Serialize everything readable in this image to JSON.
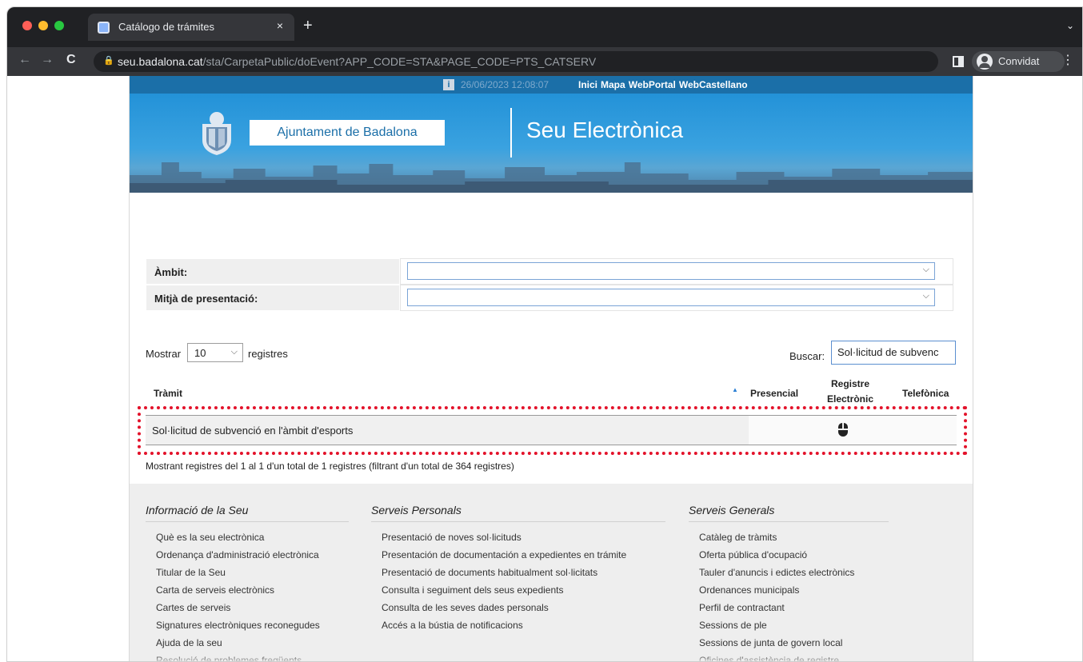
{
  "browser": {
    "tab_title": "Catálogo de trámites",
    "tab_close": "×",
    "new_tab": "+",
    "tab_menu": "⌄",
    "url_host": "seu.badalona.cat",
    "url_path": "/sta/CarpetaPublic/doEvent?APP_CODE=STA&PAGE_CODE=PTS_CATSERV",
    "profile_label": "Convidat",
    "back": "←",
    "forward": "→",
    "reload": "C",
    "menu": "⋮"
  },
  "topbar": {
    "info_icon": "i",
    "datetime": "26/06/2023 12:08:07",
    "links": [
      "Inici",
      "Mapa",
      "WebPortal",
      "WebCastellano"
    ]
  },
  "banner": {
    "org_name": "Ajuntament de Badalona",
    "site_title": "Seu Electrònica"
  },
  "filters": {
    "ambit_label": "Àmbit:",
    "mitja_label": "Mitjà de presentació:",
    "chevron": "⌵"
  },
  "table_controls": {
    "show_label": "Mostrar",
    "page_size": "10",
    "show_suffix": "registres",
    "search_label": "Buscar:",
    "search_value": "Sol·licitud de subvenc"
  },
  "table": {
    "headers": {
      "tramit": "Tràmit",
      "presencial": "Presencial",
      "registre": "Registre Electrònic",
      "telefonica": "Telefònica"
    },
    "sort_indicator": "▲",
    "rows": [
      {
        "tramit": "Sol·licitud de subvenció en l'àmbit d'esports",
        "presencial": "",
        "registre": "mouse-icon",
        "telefonica": ""
      }
    ],
    "info": "Mostrant registres del 1 al 1 d'un total de 1 registres (filtrant d'un total de 364 registres)"
  },
  "footer": {
    "col1_title": "Informació de la Seu",
    "col1_links": [
      "Què es la seu electrònica",
      "Ordenança d'administració electrònica",
      "Titular de la Seu",
      "Carta de serveis electrònics",
      "Cartes de serveis",
      "Signatures electròniques reconegudes",
      "Ajuda de la seu",
      "Resolució de problemes freqüents"
    ],
    "col2_title": "Serveis Personals",
    "col2_links": [
      "Presentació de noves sol·licituds",
      "Presentación de documentación a expedientes en trámite",
      "Presentació de documents habitualment sol·licitats",
      "Consulta i seguiment dels seus expedients",
      "Consulta de les seves dades personals",
      "Accés a la bústia de notificacions"
    ],
    "col3_title": "Serveis Generals",
    "col3_links": [
      "Catàleg de tràmits",
      "Oferta pública d'ocupació",
      "Tauler d'anuncis i edictes electrònics",
      "Ordenances municipals",
      "Perfil de contractant",
      "Sessions de ple",
      "Sessions de junta de govern local",
      "Oficines d'assistència de registre"
    ]
  },
  "colors": {
    "browser_dark": "#202124",
    "topbar_blue": "#1b6fa8",
    "banner_blue": "#2392d8",
    "highlight_red": "#e3122a"
  }
}
